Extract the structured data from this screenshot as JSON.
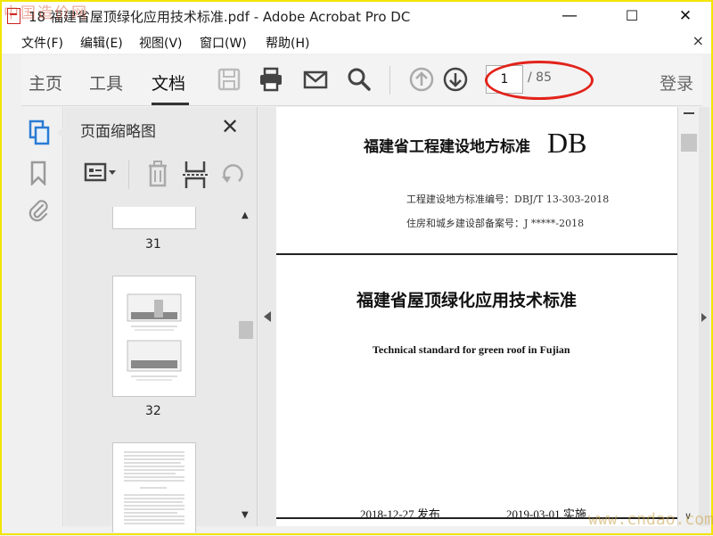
{
  "window": {
    "title": "18 福建省屋顶绿化应用技术标准.pdf - Adobe Acrobat Pro DC",
    "minimize": "—",
    "maximize": "☐",
    "close": "✕"
  },
  "watermark": {
    "top": "中国造价网",
    "bottom": "www.cndao.com"
  },
  "menu": {
    "items": [
      "文件(F)",
      "编辑(E)",
      "视图(V)",
      "窗口(W)",
      "帮助(H)"
    ],
    "close": "×"
  },
  "toolbar": {
    "tabs": [
      "主页",
      "工具",
      "文档"
    ],
    "page_current": "1",
    "page_total": "/ 85",
    "login": "登录"
  },
  "panel": {
    "title": "页面缩略图",
    "close": "✕",
    "thumbs": [
      "31",
      "32"
    ]
  },
  "document": {
    "header": "福建省工程建设地方标准",
    "db": "DB",
    "line1": "工程建设地方标准编号：DBJ/T 13-303-2018",
    "line2": "住房和城乡建设部备案号：J *****-2018",
    "title": "福建省屋顶绿化应用技术标准",
    "english": "Technical standard for green roof in Fujian",
    "release": "2018-12-27 发布",
    "implement": "2019-03-01  实施"
  },
  "colors": {
    "highlight": "#e2231a",
    "frame": "#f2e500"
  }
}
